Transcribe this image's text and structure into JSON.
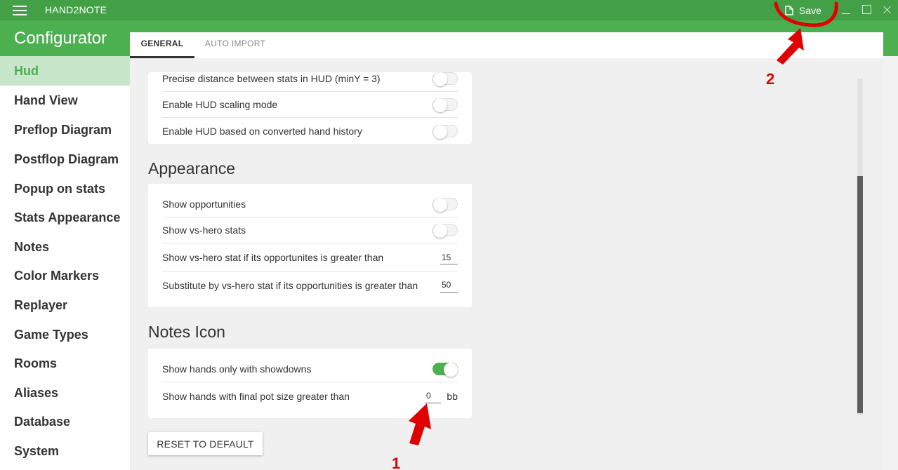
{
  "app": {
    "title": "HAND2NOTE",
    "save_label": "Save"
  },
  "header": {
    "title": "Configurator"
  },
  "sidebar": {
    "items": [
      {
        "label": "Hud",
        "active": true
      },
      {
        "label": "Hand View"
      },
      {
        "label": "Preflop Diagram"
      },
      {
        "label": "Postflop Diagram"
      },
      {
        "label": "Popup on stats"
      },
      {
        "label": "Stats Appearance"
      },
      {
        "label": "Notes"
      },
      {
        "label": "Color Markers"
      },
      {
        "label": "Replayer"
      },
      {
        "label": "Game Types"
      },
      {
        "label": "Rooms"
      },
      {
        "label": "Aliases"
      },
      {
        "label": "Database"
      },
      {
        "label": "System"
      }
    ]
  },
  "tabs": [
    {
      "label": "GENERAL",
      "active": true
    },
    {
      "label": "AUTO IMPORT"
    }
  ],
  "hud_section": {
    "rows": [
      {
        "label": "Precise distance between stats in HUD (minY = 3)",
        "enabled": false
      },
      {
        "label": "Enable HUD scaling mode",
        "enabled": false
      },
      {
        "label": "Enable HUD based on converted hand history",
        "enabled": false
      }
    ]
  },
  "appearance": {
    "title": "Appearance",
    "show_opportunities": {
      "label": "Show opportunities",
      "enabled": false
    },
    "show_vs_hero": {
      "label": "Show vs-hero stats",
      "enabled": false
    },
    "vs_hero_threshold": {
      "label": "Show vs-hero stat if its opportunites is greater than",
      "value": "15"
    },
    "substitute_threshold": {
      "label": "Substitute by vs-hero stat if its opportunities is greater than",
      "value": "50"
    }
  },
  "notes_icon": {
    "title": "Notes Icon",
    "showdowns_only": {
      "label": "Show hands only with showdowns",
      "enabled": true
    },
    "pot_size": {
      "label": "Show hands with final pot size greater than",
      "value": "0",
      "unit": "bb"
    }
  },
  "reset_label": "RESET TO DEFAULT",
  "annotations": {
    "arrow_1": "1",
    "arrow_2": "2",
    "color": "#e00000"
  },
  "colors": {
    "titlebar": "#43a047",
    "header": "#4caf50",
    "active_item_bg": "#c8e6c9",
    "accent": "#4caf50"
  }
}
